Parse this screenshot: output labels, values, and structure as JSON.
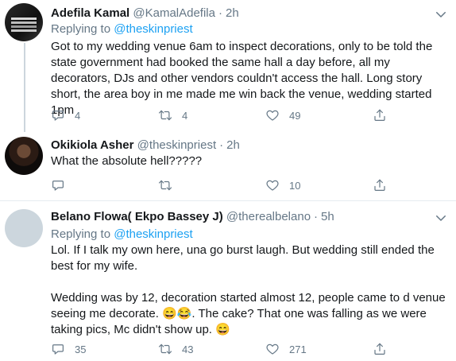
{
  "tweets": [
    {
      "name": "Adefila Kamal",
      "handle": "@KamalAdefila",
      "time": "2h",
      "replying_prefix": "Replying to",
      "replying_to": "@theskinpriest",
      "body": [
        "Got to my wedding venue 6am to inspect decorations, only to be told the state government had booked the same hall a day before, all my decorators, DJs and other vendors couldn't access the hall. Long story short, the area boy in me made me win back the venue, wedding started 1pm"
      ],
      "replies": "4",
      "retweets": "4",
      "likes": "49"
    },
    {
      "name": "Okikiola Asher",
      "handle": "@theskinpriest",
      "time": "2h",
      "body": [
        "What the absolute hell?????"
      ],
      "replies": "",
      "retweets": "",
      "likes": "10"
    },
    {
      "name": "Belano Flowa( Ekpo Bassey J)",
      "handle": "@therealbelano",
      "time": "5h",
      "replying_prefix": "Replying to",
      "replying_to": "@theskinpriest",
      "body": [
        "Lol. If I talk my own here, una go burst laugh. But wedding still ended the best for my wife.",
        "Wedding was by 12, decoration started almost 12, people came to d venue seeing me decorate. 😄😂. The cake? That one was falling as we were taking pics, Mc didn't show up. 😄"
      ],
      "replies": "35",
      "retweets": "43",
      "likes": "271"
    }
  ],
  "icons": {
    "reply": "reply-icon",
    "retweet": "retweet-icon",
    "like": "heart-icon",
    "share": "share-icon",
    "more": "chevron-down-icon"
  },
  "colors": {
    "text": "#14171a",
    "secondary": "#657786",
    "link": "#1da1f2",
    "divider": "#e6ecf0"
  }
}
